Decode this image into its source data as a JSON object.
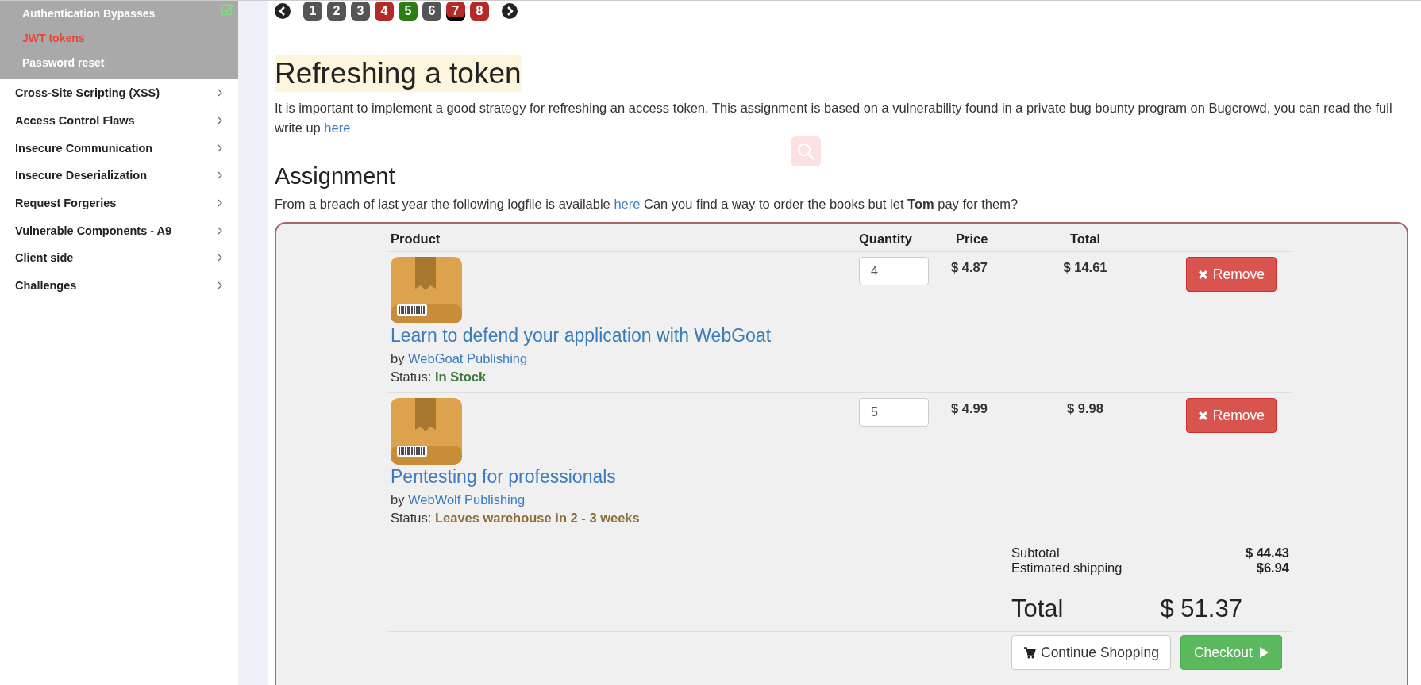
{
  "sidebar": {
    "subitems": [
      {
        "label": "Authentication Bypasses",
        "completed": true,
        "selected": false
      },
      {
        "label": "JWT tokens",
        "completed": false,
        "selected": true
      },
      {
        "label": "Password reset",
        "completed": false,
        "selected": false
      }
    ],
    "categories": [
      {
        "label": "Cross-Site Scripting (XSS)"
      },
      {
        "label": "Access Control Flaws"
      },
      {
        "label": "Insecure Communication"
      },
      {
        "label": "Insecure Deserialization"
      },
      {
        "label": "Request Forgeries"
      },
      {
        "label": "Vulnerable Components - A9"
      },
      {
        "label": "Client side"
      },
      {
        "label": "Challenges"
      }
    ]
  },
  "lesson_pages": [
    {
      "label": "1",
      "color": "#555555",
      "selected": false
    },
    {
      "label": "2",
      "color": "#555555",
      "selected": false
    },
    {
      "label": "3",
      "color": "#555555",
      "selected": false
    },
    {
      "label": "4",
      "color": "#b52a25",
      "selected": false
    },
    {
      "label": "5",
      "color": "#2e7d12",
      "selected": false
    },
    {
      "label": "6",
      "color": "#555555",
      "selected": false
    },
    {
      "label": "7",
      "color": "#b52a25",
      "selected": true
    },
    {
      "label": "8",
      "color": "#b52a25",
      "selected": false
    }
  ],
  "title": "Refreshing a token",
  "intro": "It is important to implement a good strategy for refreshing an access token. This assignment is based on a vulnerability found in a private bug bounty program on Bugcrowd, you can read the full write up",
  "intro_link": "here",
  "assignment_heading": "Assignment",
  "assignment_before": "From a breach of last year the following logfile is available",
  "assignment_link": "here",
  "assignment_after": "Can you find a way to order the books but let **Tom** pay for them?",
  "cart": {
    "columns": [
      "Product",
      "Quantity",
      "Price",
      "Total"
    ],
    "rows": [
      {
        "title": "Learn to defend your application with WebGoat",
        "by": "by",
        "publisher": "WebGoat Publishing",
        "status_label": "Status:",
        "status": "In Stock",
        "kind": "in_stock",
        "quantity": "4",
        "price": "$ 4.87",
        "total": "$ 14.61",
        "remove": "Remove"
      },
      {
        "title": "Pentesting for professionals",
        "by": "by",
        "publisher": "WebWolf Publishing",
        "status_label": "Status:",
        "status": "Leaves warehouse in 2 - 3 weeks",
        "kind": "delayed",
        "quantity": "5",
        "price": "$ 4.99",
        "total": "$ 9.98",
        "remove": "Remove"
      }
    ],
    "subtotal_label": "Subtotal",
    "subtotal": "$ 44.43",
    "shipping_label": "Estimated shipping",
    "shipping": "$6.94",
    "total_label": "Total",
    "total": "$ 51.37",
    "continue": "Continue Shopping",
    "checkout": "Checkout"
  }
}
